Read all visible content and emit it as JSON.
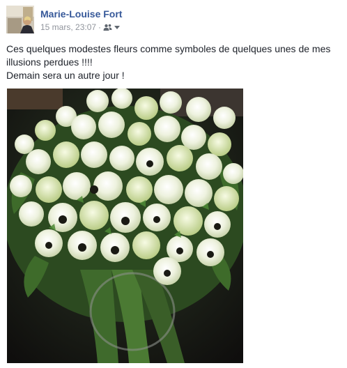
{
  "post": {
    "author_name": "Marie-Louise Fort",
    "timestamp": "15 mars, 23:07",
    "separator": "·",
    "audience_icon": "friends-icon",
    "text_line_1": "Ces quelques modestes fleurs comme symboles de quelques unes de mes illusions perdues !!!!",
    "text_line_2": "Demain sera un autre jour !",
    "photo": {
      "subject": "bouquet of white anemones",
      "dominant_colors": [
        "#f1f4e6",
        "#2f4a1f",
        "#141313"
      ]
    }
  },
  "colors": {
    "author_link": "#365899",
    "meta_text": "#90949c",
    "body_text": "#1d2129"
  }
}
